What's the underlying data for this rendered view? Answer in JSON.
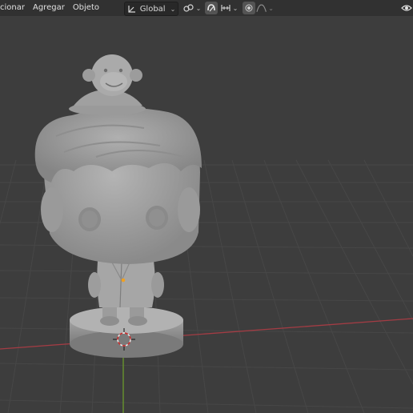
{
  "menu": {
    "select_label": "cionar",
    "add_label": "Agregar",
    "object_label": "Objeto"
  },
  "toolbar": {
    "transform_orientation": "Global",
    "pivot_icon": "pivot-chain-icon",
    "snap_icon": "magnet-icon",
    "snap_increment_icon": "snap-increment-icon",
    "proportional_icon": "proportional-edit-icon",
    "falloff_icon": "falloff-curve-icon",
    "visibility_icon": "eye-icon"
  },
  "colors": {
    "viewport_bg": "#3d3d3d",
    "grid": "#474747",
    "x_axis": "#a33c44",
    "y_axis": "#6a9a2c",
    "model": "#a8a8a8",
    "origin": "#f0a020"
  }
}
